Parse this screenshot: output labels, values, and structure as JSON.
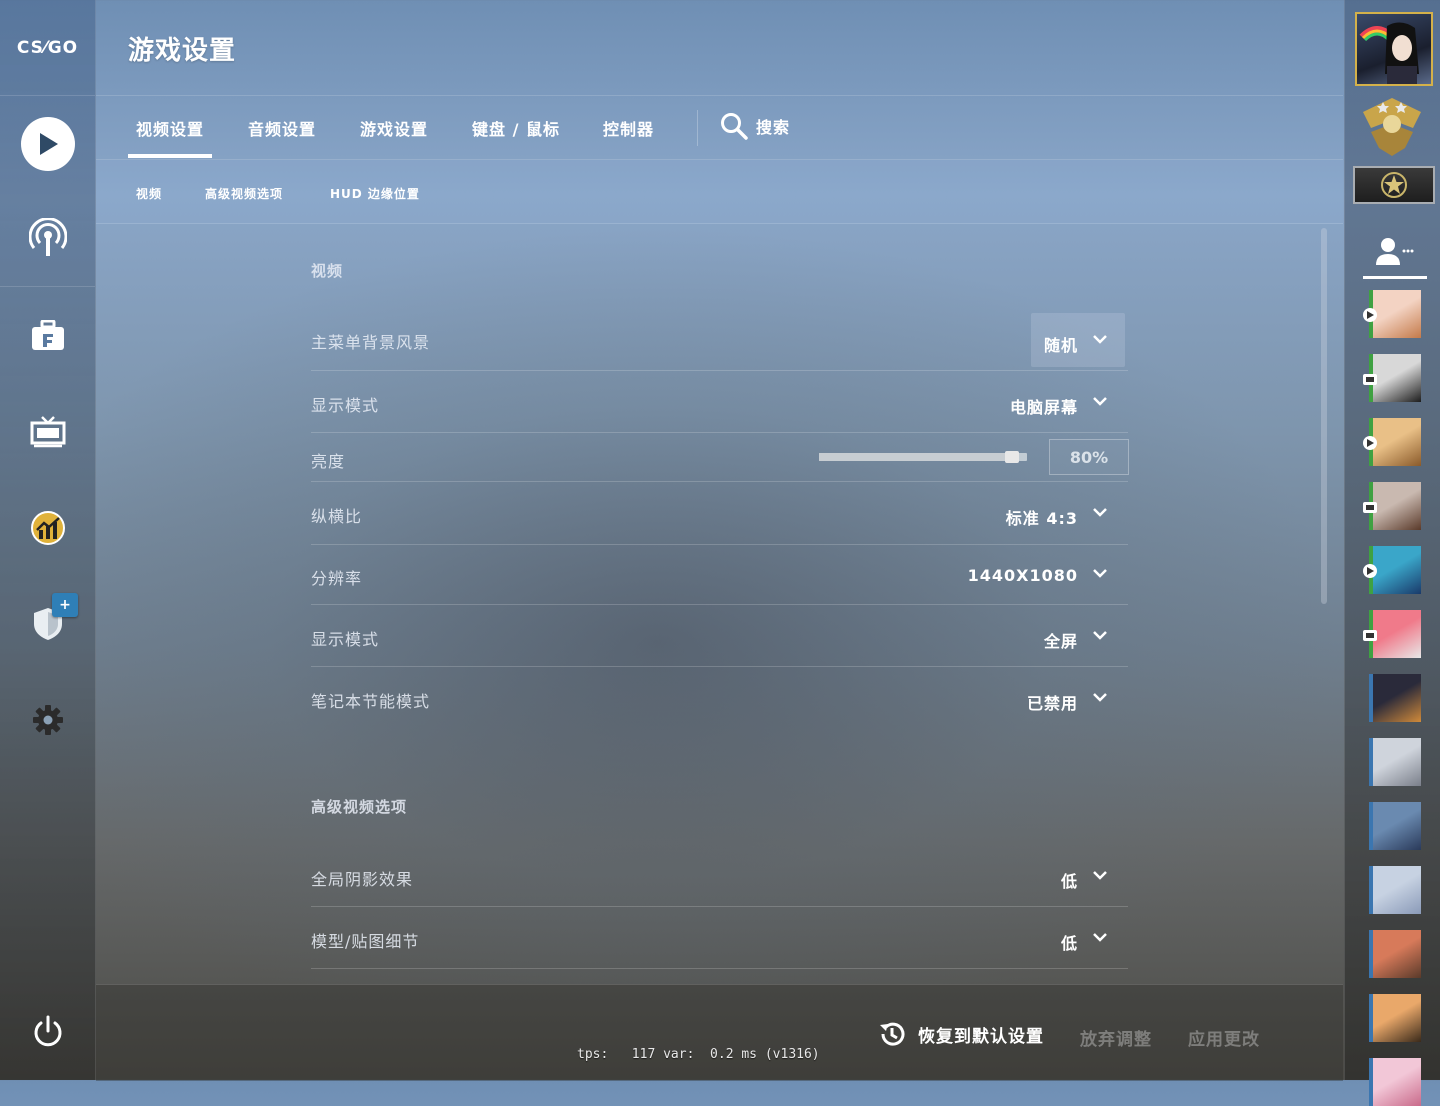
{
  "app": {
    "logo_text": "CS⁄GO",
    "title": "游戏设置"
  },
  "tabs": [
    {
      "label": "视频设置",
      "active": true
    },
    {
      "label": "音频设置"
    },
    {
      "label": "游戏设置"
    },
    {
      "label": "键盘 / 鼠标"
    },
    {
      "label": "控制器"
    }
  ],
  "search": {
    "label": "搜索"
  },
  "subtabs": [
    "视频",
    "高级视频选项",
    "HUD 边缘位置"
  ],
  "sections": {
    "video": {
      "title": "视频",
      "rows": [
        {
          "label": "主菜单背景风景",
          "value": "随机"
        },
        {
          "label": "显示模式",
          "value": "电脑屏幕"
        },
        {
          "label": "亮度",
          "value": "80%",
          "slider_fraction": 0.93
        },
        {
          "label": "纵横比",
          "value": "标准 4:3"
        },
        {
          "label": "分辨率",
          "value": "1440X1080"
        },
        {
          "label": "显示模式",
          "value": "全屏"
        },
        {
          "label": "笔记本节能模式",
          "value": "已禁用"
        }
      ]
    },
    "advanced": {
      "title": "高级视频选项",
      "rows": [
        {
          "label": "全局阴影效果",
          "value": "低"
        },
        {
          "label": "模型/贴图细节",
          "value": "低"
        }
      ]
    }
  },
  "footer": {
    "restore_label": "恢复到默认设置",
    "discard_label": "放弃调整",
    "apply_label": "应用更改"
  },
  "perf": {
    "text": "tps:   117 var:  0.2 ms (v1316)"
  },
  "sidebar_icons": [
    "play-icon",
    "broadcast-icon",
    "inventory-icon",
    "watch-tv-icon",
    "stats-icon",
    "shield-icon",
    "gear-icon",
    "power-icon"
  ],
  "friends": [
    {
      "status": "playing",
      "online": true
    },
    {
      "status": "watching",
      "online": true
    },
    {
      "status": "playing",
      "online": true
    },
    {
      "status": "watching",
      "online": true
    },
    {
      "status": "playing",
      "online": true
    },
    {
      "status": "watching",
      "online": true
    },
    {
      "status": "",
      "online": false
    },
    {
      "status": "",
      "online": false
    },
    {
      "status": "",
      "online": false
    },
    {
      "status": "",
      "online": false
    },
    {
      "status": "",
      "online": false
    },
    {
      "status": "",
      "online": false
    },
    {
      "status": "",
      "online": false
    }
  ],
  "colors": {
    "accent_badge": "#2f7fb7",
    "online": "#3fa142",
    "offline": "#3b76b0",
    "avatar_border": "#d4b14a"
  }
}
